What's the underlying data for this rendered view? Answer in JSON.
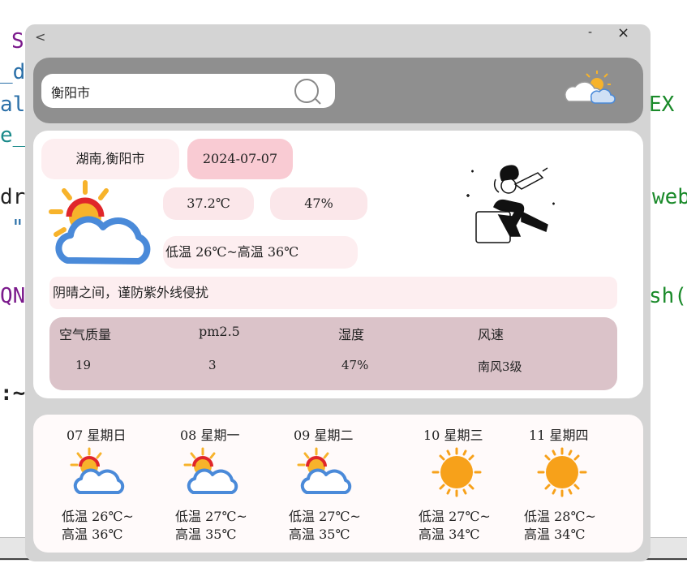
{
  "background_code": {
    "lines": [
      "S",
      "_d",
      "al",
      "e_",
      "dr",
      "\"",
      "QN",
      ":~"
    ],
    "right_lines": [
      "EX",
      "web",
      "sh("
    ]
  },
  "window": {
    "back": "<",
    "minimize": "-",
    "close": "×"
  },
  "search": {
    "value": "衡阳市",
    "placeholder": ""
  },
  "current": {
    "location": "湖南,衡阳市",
    "date": "2024-07-07",
    "temperature": "37.2℃",
    "humidity": "47%",
    "range": "低温 26℃~高温 36℃",
    "tip": "阴晴之间，谨防紫外线侵扰"
  },
  "air": {
    "headers": [
      "空气质量",
      "pm2.5",
      "湿度",
      "风速"
    ],
    "values": [
      "19",
      "3",
      "47%",
      "南风3级"
    ]
  },
  "forecast": [
    {
      "label": "07  星期日",
      "icon": "partly-cloudy",
      "low": "低温  26℃~",
      "high": "高温  36℃"
    },
    {
      "label": "08  星期一",
      "icon": "partly-cloudy",
      "low": "低温  27℃~",
      "high": "高温  35℃"
    },
    {
      "label": "09  星期二",
      "icon": "partly-cloudy",
      "low": "低温  27℃~",
      "high": "高温  35℃"
    },
    {
      "label": "10  星期三",
      "icon": "sunny",
      "low": "低温  27℃~",
      "high": "高温  34℃"
    },
    {
      "label": "11  星期四",
      "icon": "sunny",
      "low": "低温  28℃~",
      "high": "高温  34℃"
    }
  ],
  "colors": {
    "sun": "#f7b32b",
    "sun_red": "#e0262a",
    "cloud": "#4a8ad9",
    "sunny": "#f7a11a",
    "header_bar": "#8f8f8f",
    "pink_pill": "#fdeef0",
    "date_pill": "#f9cbd3",
    "aqi_panel": "#dbc3c9"
  }
}
